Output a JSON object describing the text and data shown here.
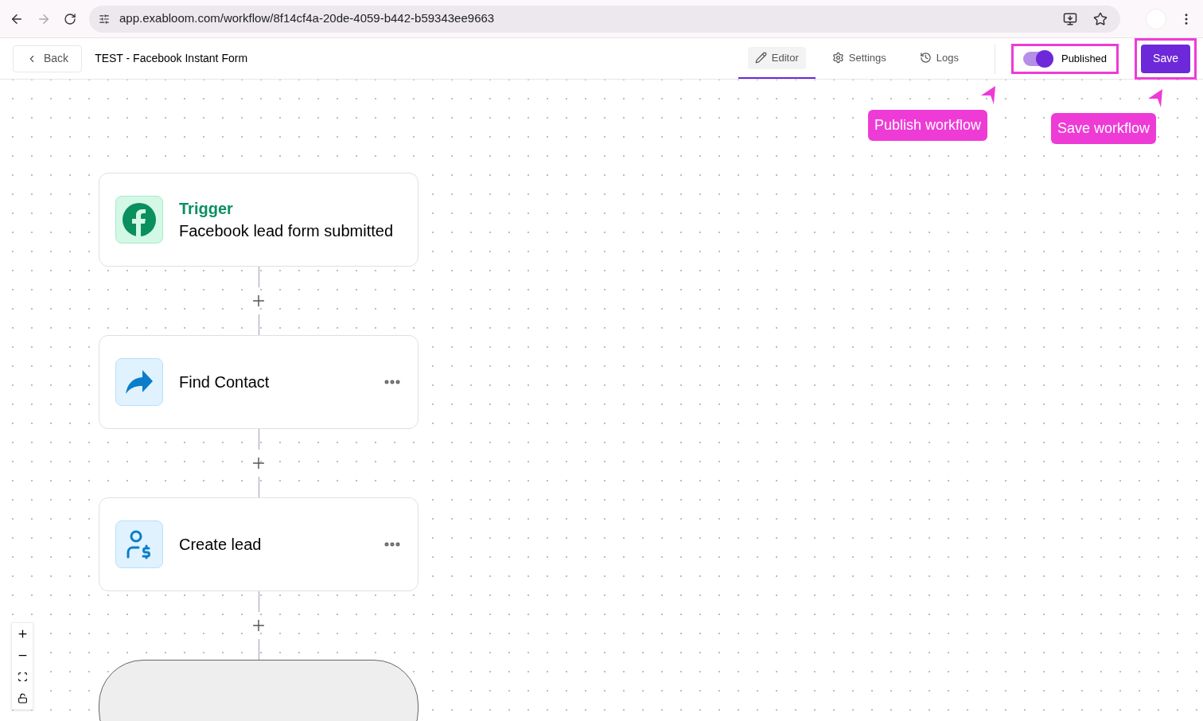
{
  "browser": {
    "url": "app.exabloom.com/workflow/8f14cf4a-20de-4059-b442-b59343ee9663"
  },
  "header": {
    "back": "Back",
    "title": "TEST - Facebook Instant Form",
    "tabs": [
      {
        "label": "Editor",
        "selected": true
      },
      {
        "label": "Settings",
        "selected": false
      },
      {
        "label": "Logs",
        "selected": false
      }
    ],
    "publish": {
      "label": "Published",
      "on": true,
      "highlighted": true
    },
    "save": {
      "label": "Save",
      "highlighted": true
    }
  },
  "annotations": [
    {
      "text": "Publish workflow"
    },
    {
      "text": "Save workflow"
    }
  ],
  "nodes": [
    {
      "kind": "trigger",
      "tag": "Trigger",
      "title": "Facebook lead form submitted"
    },
    {
      "kind": "action",
      "title": "Find Contact"
    },
    {
      "kind": "action",
      "title": "Create lead"
    },
    {
      "kind": "end"
    }
  ]
}
